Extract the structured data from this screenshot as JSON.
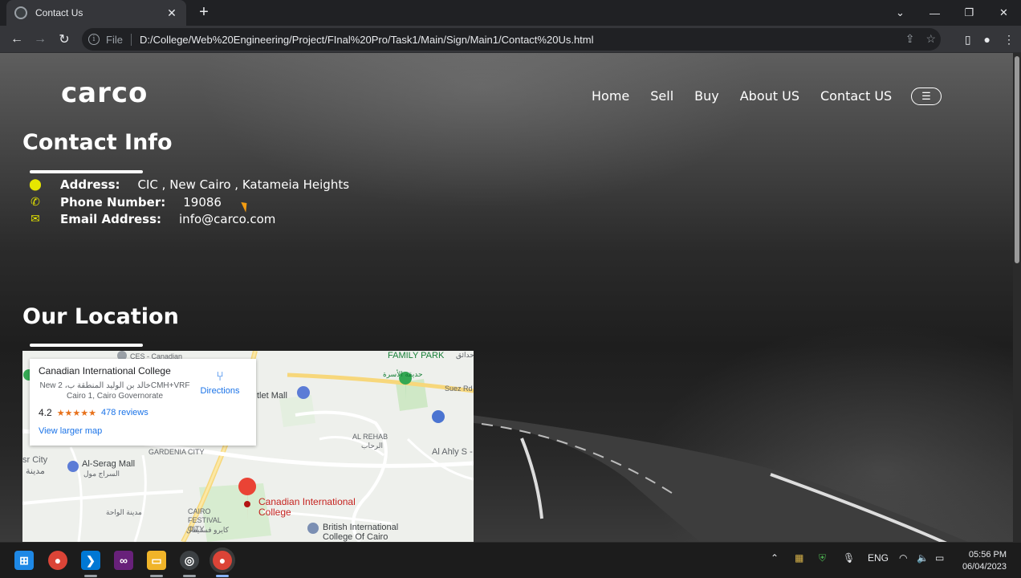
{
  "browser": {
    "tab_title": "Contact Us",
    "url_scheme_label": "File",
    "url": "D:/College/Web%20Engineering/Project/FInal%20Pro/Task1/Main/Sign/Main1/Contact%20Us.html"
  },
  "site": {
    "logo": "carco",
    "nav": [
      "Home",
      "Sell",
      "Buy",
      "About US",
      "Contact US"
    ],
    "contact_heading": "Contact Info",
    "contact": {
      "address_label": "Address:",
      "address_value": "CIC , New Cairo , Katameia Heights",
      "phone_label": "Phone Number:",
      "phone_value": "19086",
      "email_label": "Email Address:",
      "email_value": "info@carco.com"
    },
    "location_heading": "Our Location"
  },
  "map": {
    "place_name": "Canadian International College",
    "place_address": "New خالد بن الوليد المنطقة ب، 2CMH+VRF Cairo 1, Cairo Governorate",
    "rating": "4.2",
    "stars": "★★★★★",
    "reviews": "478 reviews",
    "view_larger": "View larger map",
    "directions": "Directions",
    "labels": {
      "family_park": "FAMILY PARK",
      "family_park_ar": "حديقة الأسرة",
      "outlet_mall": "tlet Mall",
      "al_rehab": "AL REHAB",
      "al_rehab_ar": "الرحاب",
      "al_ahly": "Al Ahly S - Fift",
      "suez_rd": "Suez Rd",
      "gardenia": "GARDENIA CITY",
      "al_serag": "Al-Serag Mall",
      "al_serag_ar": "السراج مول",
      "sr_city": "sr City",
      "sr_city_ar": "مدينة",
      "cairo_festival": "CAIRO FESTIVAL CITY",
      "cairo_festival_ar": "كايرو فستيفال",
      "cic_pin": "Canadian International College",
      "british": "British International College Of Cairo",
      "ces": "CES - Canadian",
      "top_ar": "حدائق",
      "wahat_ar": "مدينة الواحة"
    }
  },
  "taskbar": {
    "lang": "ENG",
    "time": "05:56 PM",
    "date": "06/04/2023"
  }
}
